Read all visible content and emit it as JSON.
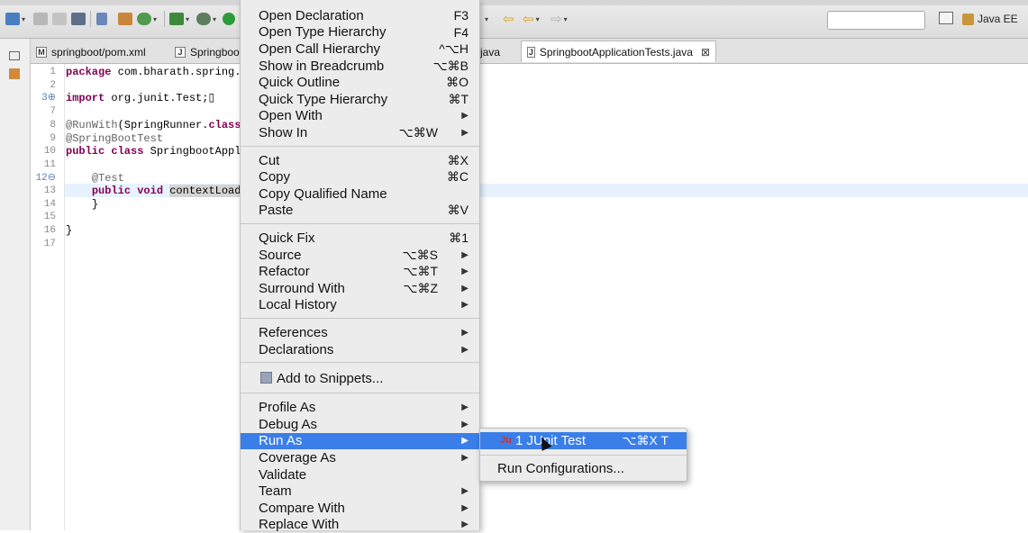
{
  "toolbar": {
    "perspective_label": "Java EE",
    "icons": [
      "new-icon",
      "save-icon",
      "save-all-icon",
      "print-icon",
      "pin-icon",
      "build-icon",
      "refresh-icon",
      "server-icon",
      "debug-icon",
      "run-icon",
      "back-icon",
      "forward-icon",
      "open-perspective-icon",
      "java-ee-perspective-icon"
    ]
  },
  "tabs": [
    {
      "label": "springboot/pom.xml",
      "icon": "M"
    },
    {
      "label": "Springboot",
      "icon": "J"
    },
    {
      "label": "java",
      "icon": ""
    },
    {
      "label": "SpringbootApplicationTests.java",
      "icon": "J",
      "close": "⊠"
    }
  ],
  "editor": {
    "line_numbers": [
      "1",
      "2",
      "3⊕",
      "7",
      "8",
      "9",
      "10",
      "11",
      "12⊖",
      "13",
      "14",
      "15",
      "16",
      "17"
    ],
    "lines": [
      {
        "pre": "",
        "kw": "package",
        "post": " com.bharath.spring.bo"
      },
      {
        "pre": "",
        "kw": "",
        "post": ""
      },
      {
        "pre": "",
        "kw": "import",
        "post": " org.junit.Test;▯"
      },
      {
        "pre": "",
        "kw": "",
        "post": ""
      },
      {
        "pre": "",
        "ann": "@RunWith",
        "post": "(SpringRunner.",
        "kw2": "class",
        "post2": ")"
      },
      {
        "pre": "",
        "ann": "@SpringBootTest",
        "post": ""
      },
      {
        "pre": "",
        "kw": "public class",
        "post": " SpringbootAppli"
      },
      {
        "pre": "",
        "kw": "",
        "post": ""
      },
      {
        "pre": "    ",
        "ann": "@Test",
        "post": ""
      },
      {
        "pre": "    ",
        "kw": "public void",
        "post": " ",
        "sel": "contextLoads"
      },
      {
        "pre": "    ",
        "kw": "",
        "post": "}"
      },
      {
        "pre": "",
        "kw": "",
        "post": ""
      },
      {
        "pre": "",
        "kw": "",
        "post": "}"
      },
      {
        "pre": "",
        "kw": "",
        "post": ""
      }
    ]
  },
  "context_menu": {
    "groups": [
      [
        {
          "label": "Open Declaration",
          "shortcut": "F3"
        },
        {
          "label": "Open Type Hierarchy",
          "shortcut": "F4"
        },
        {
          "label": "Open Call Hierarchy",
          "shortcut": "^⌥H"
        },
        {
          "label": "Show in Breadcrumb",
          "shortcut": "⌥⌘B"
        },
        {
          "label": "Quick Outline",
          "shortcut": "⌘O"
        },
        {
          "label": "Quick Type Hierarchy",
          "shortcut": "⌘T"
        },
        {
          "label": "Open With",
          "submenu": true
        },
        {
          "label": "Show In",
          "shortcut": "⌥⌘W",
          "submenu": true
        }
      ],
      [
        {
          "label": "Cut",
          "shortcut": "⌘X"
        },
        {
          "label": "Copy",
          "shortcut": "⌘C"
        },
        {
          "label": "Copy Qualified Name"
        },
        {
          "label": "Paste",
          "shortcut": "⌘V"
        }
      ],
      [
        {
          "label": "Quick Fix",
          "shortcut": "⌘1"
        },
        {
          "label": "Source",
          "shortcut": "⌥⌘S",
          "submenu": true
        },
        {
          "label": "Refactor",
          "shortcut": "⌥⌘T",
          "submenu": true
        },
        {
          "label": "Surround With",
          "shortcut": "⌥⌘Z",
          "submenu": true
        },
        {
          "label": "Local History",
          "submenu": true
        }
      ],
      [
        {
          "label": "References",
          "submenu": true
        },
        {
          "label": "Declarations",
          "submenu": true
        }
      ],
      [
        {
          "label": "Add to Snippets...",
          "icon": "snippet-icon"
        }
      ],
      [
        {
          "label": "Profile As",
          "submenu": true
        },
        {
          "label": "Debug As",
          "submenu": true
        },
        {
          "label": "Run As",
          "submenu": true,
          "selected": true
        },
        {
          "label": "Coverage As",
          "submenu": true
        },
        {
          "label": "Validate"
        },
        {
          "label": "Team",
          "submenu": true
        },
        {
          "label": "Compare With",
          "submenu": true
        },
        {
          "label": "Replace With",
          "submenu": true
        }
      ]
    ]
  },
  "submenu": {
    "items": [
      {
        "label": "1 JUnit Test",
        "shortcut": "⌥⌘X T",
        "selected": true,
        "icon": "junit-icon"
      },
      {
        "label": "Run Configurations..."
      }
    ]
  },
  "colors": {
    "selection": "#3a7ee9",
    "keyword": "#7f0055",
    "annotation": "#646464",
    "current_line": "#e8f2fe"
  }
}
